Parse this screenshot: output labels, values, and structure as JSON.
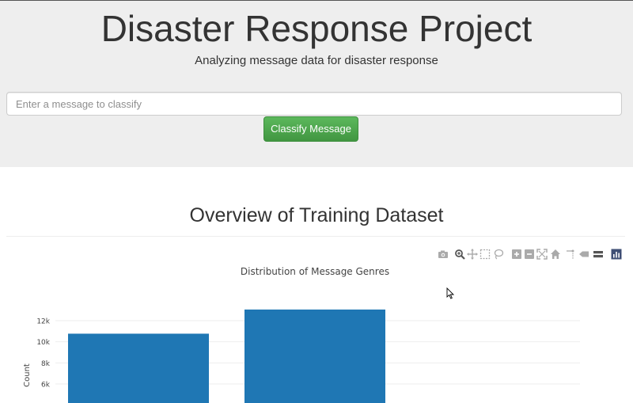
{
  "header": {
    "title": "Disaster Response Project",
    "subtitle": "Analyzing message data for disaster response"
  },
  "form": {
    "placeholder": "Enter a message to classify",
    "button_label": "Classify Message"
  },
  "section": {
    "title": "Overview of Training Dataset"
  },
  "modebar": {
    "icons": [
      "camera-icon",
      "zoom-icon",
      "pan-icon",
      "box-select-icon",
      "lasso-icon",
      "zoom-in-icon",
      "zoom-out-icon",
      "autoscale-icon",
      "reset-axes-icon",
      "spike-lines-icon",
      "hover-closest-icon",
      "hover-compare-icon",
      "plotly-logo-icon"
    ]
  },
  "colors": {
    "accent_green": "#5cb85c",
    "bar_blue": "#1f77b4",
    "jumbotron_bg": "#eeeeee"
  },
  "chart_data": {
    "type": "bar",
    "title": "Distribution of Message Genres",
    "xlabel": "",
    "ylabel": "Count",
    "categories": [
      "",
      ""
    ],
    "values": [
      10766,
      13054
    ],
    "y_tick_labels": [
      "6k",
      "8k",
      "10k",
      "12k"
    ],
    "y_ticks": [
      6000,
      8000,
      10000,
      12000
    ],
    "grid": true,
    "note": "x-axis category labels and lower part of the chart are cut off in the screenshot; a third category lies off-view"
  }
}
